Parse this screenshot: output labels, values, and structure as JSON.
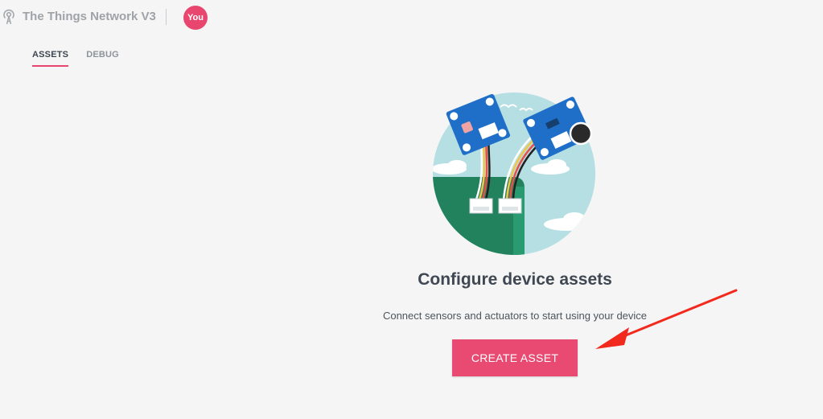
{
  "header": {
    "network_name": "The Things Network V3",
    "avatar_label": "You"
  },
  "tabs": [
    {
      "label": "ASSETS",
      "active": true
    },
    {
      "label": "DEBUG",
      "active": false
    }
  ],
  "empty_state": {
    "title": "Configure device assets",
    "description": "Connect sensors and actuators to start using your device",
    "button_label": "CREATE ASSET"
  },
  "colors": {
    "accent": "#e8466f",
    "annotation_arrow": "#f22a1e"
  },
  "icons": {
    "network": "antenna-icon",
    "illustration": "sensor-modules-illustration",
    "annotation": "red-arrow-annotation"
  }
}
